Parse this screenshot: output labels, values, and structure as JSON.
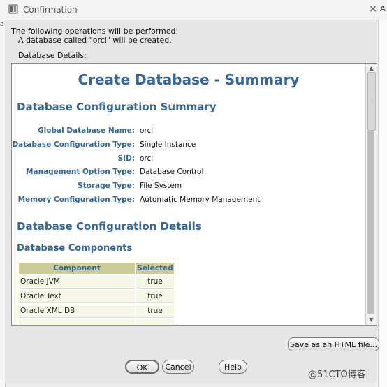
{
  "window": {
    "title": "Confirmation",
    "artifact_right": "A",
    "artifact_left": "a"
  },
  "intro": {
    "line1": "The following operations will be performed:",
    "line2": "A database called \"orcl\" will be created.",
    "details_label": "Database Details:"
  },
  "summary": {
    "title": "Create Database - Summary",
    "config_summary_heading": "Database Configuration Summary",
    "fields": [
      {
        "label": "Global Database Name:",
        "value": "orcl"
      },
      {
        "label": "Database Configuration Type:",
        "value": "Single Instance"
      },
      {
        "label": "SID:",
        "value": "orcl"
      },
      {
        "label": "Management Option Type:",
        "value": "Database Control"
      },
      {
        "label": "Storage Type:",
        "value": "File System"
      },
      {
        "label": "Memory Configuration Type:",
        "value": "Automatic Memory Management"
      }
    ],
    "config_details_heading": "Database Configuration Details",
    "components_heading": "Database Components",
    "components_table": {
      "headers": [
        "Component",
        "Selected"
      ],
      "rows": [
        [
          "Oracle JVM",
          "true"
        ],
        [
          "Oracle Text",
          "true"
        ],
        [
          "Oracle XML DB",
          "true"
        ],
        [
          "",
          ""
        ]
      ]
    }
  },
  "buttons": {
    "save_html": "Save as an HTML file...",
    "ok": "OK",
    "cancel": "Cancel",
    "help": "Help"
  },
  "watermark": "@51CTO博客",
  "colors": {
    "heading_blue": "#336699",
    "table_header_bg": "#cccc99",
    "dialog_bg": "#e6e6e6"
  }
}
